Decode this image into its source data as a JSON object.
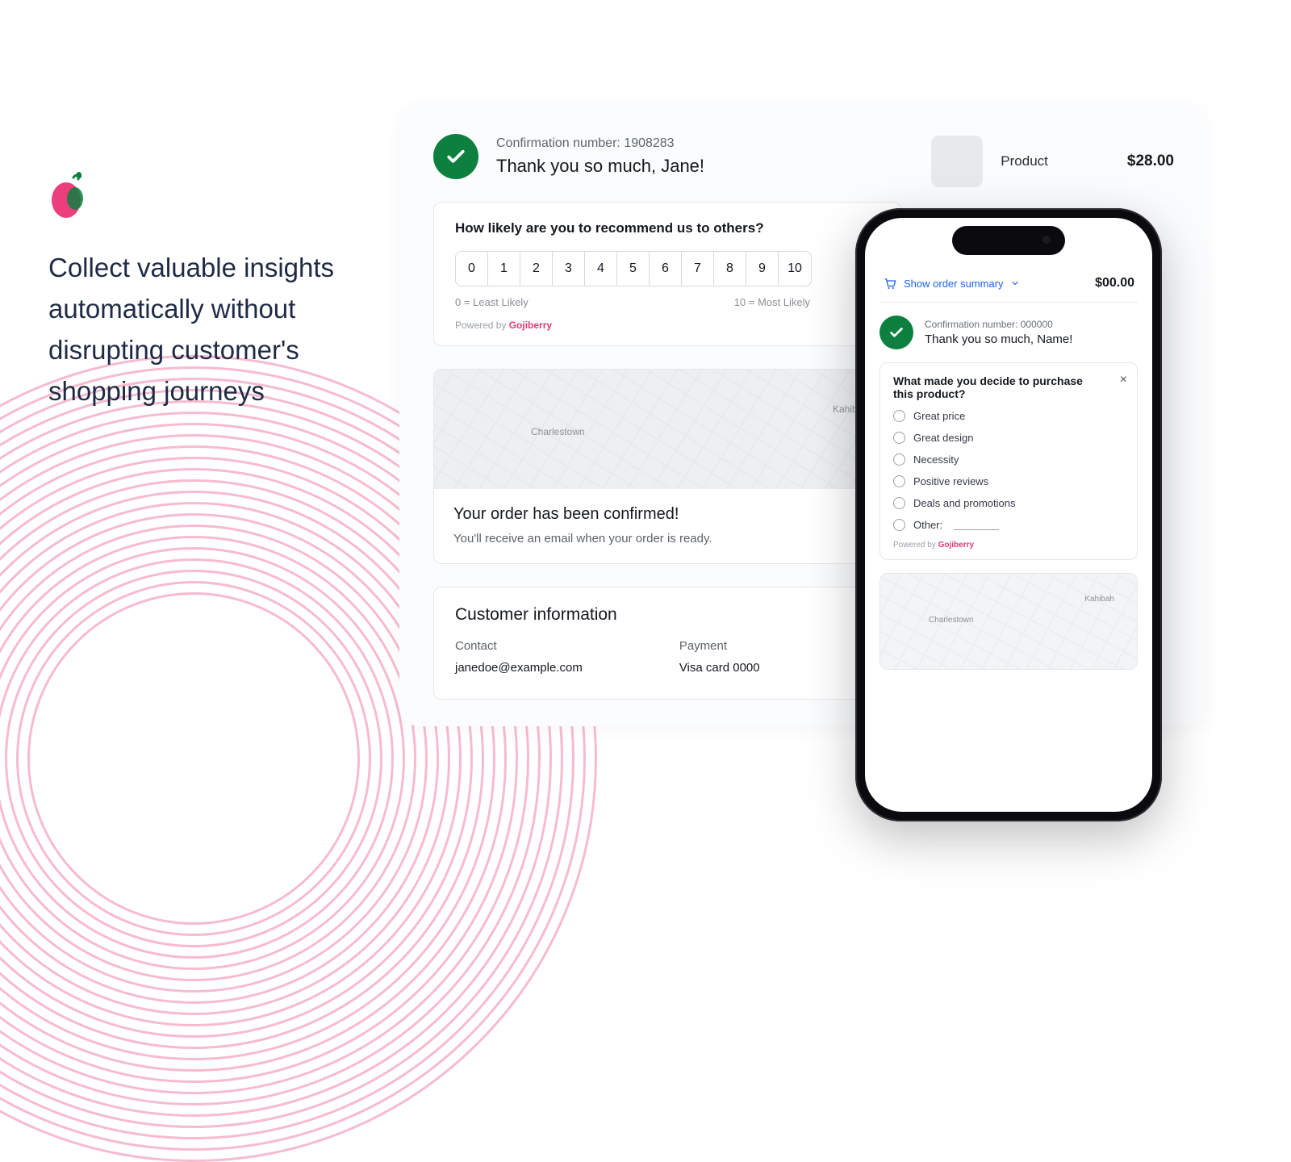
{
  "headline": "Collect valuable insights automatically without disrupting customer's shopping journeys",
  "desktop": {
    "confirmation_line": "Confirmation number: 1908283",
    "thank_you": "Thank you so much, Jane!",
    "product": {
      "label": "Product",
      "price": "$28.00"
    },
    "nps": {
      "question": "How likely are you to recommend us to others?",
      "scale": [
        "0",
        "1",
        "2",
        "3",
        "4",
        "5",
        "6",
        "7",
        "8",
        "9",
        "10"
      ],
      "legend_low": "0 = Least Likely",
      "legend_high": "10 = Most Likely",
      "powered_prefix": "Powered by ",
      "powered_brand": "Gojiberry"
    },
    "map_labels": {
      "left": "Charlestown",
      "right": "Kahibah"
    },
    "confirmed": {
      "title": "Your order has been confirmed!",
      "body": "You'll receive an email when your order is ready."
    },
    "customer": {
      "heading": "Customer information",
      "contact_label": "Contact",
      "contact_value": "janedoe@example.com",
      "payment_label": "Payment",
      "payment_value": "Visa card 0000"
    }
  },
  "phone": {
    "summary_label": "Show order summary",
    "summary_price": "$00.00",
    "confirmation_line": "Confirmation number: 000000",
    "thank_you": "Thank you so much, Name!",
    "survey": {
      "question": "What made you decide to purchase this product?",
      "options": [
        "Great price",
        "Great design",
        "Necessity",
        "Positive reviews",
        "Deals and promotions"
      ],
      "other_label": "Other:",
      "powered_prefix": "Powered by ",
      "powered_brand": "Gojiberry"
    },
    "map_labels": {
      "left": "Charlestown",
      "right": "Kahibah"
    }
  }
}
